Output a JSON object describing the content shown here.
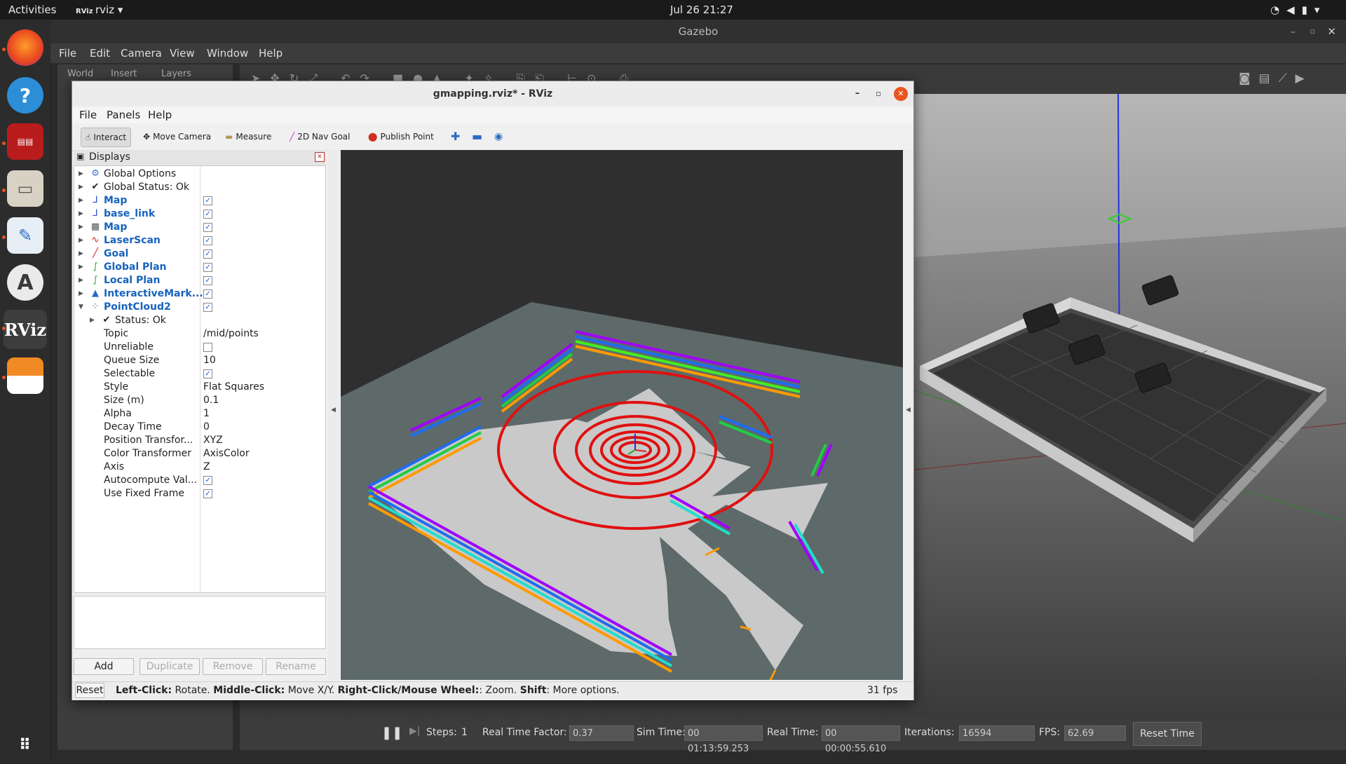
{
  "topbar": {
    "activities": "Activities",
    "app_name": "rviz",
    "clock": "Jul 26  21:27"
  },
  "dock": {
    "rviz_label": "RViz"
  },
  "gazebo": {
    "title": "Gazebo",
    "menu": [
      "File",
      "Edit",
      "Camera",
      "View",
      "Window",
      "Help"
    ],
    "left_tabs": [
      "World",
      "Insert",
      "Layers"
    ],
    "bottom": {
      "steps_label": "Steps:",
      "steps_value": "1",
      "rtf_label": "Real Time Factor:",
      "rtf_value": "0.37",
      "sim_label": "Sim Time:",
      "sim_value": "00 01:13:59.253",
      "real_label": "Real Time:",
      "real_value": "00 00:00:55.610",
      "iter_label": "Iterations:",
      "iter_value": "16594",
      "fps_label": "FPS:",
      "fps_value": "62.69",
      "reset_time": "Reset Time"
    }
  },
  "rviz": {
    "title": "gmapping.rviz* - RViz",
    "menu": [
      "File",
      "Panels",
      "Help"
    ],
    "tools": [
      "Interact",
      "Move Camera",
      "Measure",
      "2D Nav Goal",
      "Publish Point"
    ],
    "panel_title": "Displays",
    "displays": [
      {
        "label": "Global Options",
        "style": "plain",
        "icon": "gear-icon"
      },
      {
        "label": "Global Status: Ok",
        "style": "plain",
        "icon": "check-icon"
      },
      {
        "label": "Map",
        "style": "blue",
        "icon": "axes-icon",
        "checked": true
      },
      {
        "label": "base_link",
        "style": "blue",
        "icon": "axes-icon",
        "checked": true
      },
      {
        "label": "Map",
        "style": "blue",
        "icon": "grid-map-icon",
        "checked": true
      },
      {
        "label": "LaserScan",
        "style": "blue",
        "icon": "laser-icon",
        "checked": true
      },
      {
        "label": "Goal",
        "style": "blue",
        "icon": "arrow-icon",
        "checked": true
      },
      {
        "label": "Global Plan",
        "style": "blue",
        "icon": "path-icon",
        "checked": true
      },
      {
        "label": "Local Plan",
        "style": "blue",
        "icon": "path-icon",
        "checked": true
      },
      {
        "label": "InteractiveMark...",
        "style": "blue",
        "icon": "marker-icon",
        "checked": true
      },
      {
        "label": "PointCloud2",
        "style": "blue",
        "icon": "pointcloud-icon",
        "checked": true
      }
    ],
    "pc2_status": "Status: Ok",
    "properties": [
      {
        "name": "Topic",
        "value": "/mid/points"
      },
      {
        "name": "Unreliable",
        "checkbox": false
      },
      {
        "name": "Queue Size",
        "value": "10"
      },
      {
        "name": "Selectable",
        "checkbox": true
      },
      {
        "name": "Style",
        "value": "Flat Squares"
      },
      {
        "name": "Size (m)",
        "value": "0.1"
      },
      {
        "name": "Alpha",
        "value": "1"
      },
      {
        "name": "Decay Time",
        "value": "0"
      },
      {
        "name": "Position Transfor...",
        "value": "XYZ"
      },
      {
        "name": "Color Transformer",
        "value": "AxisColor"
      },
      {
        "name": "Axis",
        "value": "Z"
      },
      {
        "name": "Autocompute Val...",
        "checkbox": true
      },
      {
        "name": "Use Fixed Frame",
        "checkbox": true
      }
    ],
    "buttons": {
      "add": "Add",
      "duplicate": "Duplicate",
      "remove": "Remove",
      "rename": "Rename"
    },
    "status": {
      "reset": "Reset",
      "b1": "Left-Click:",
      "t1": " Rotate. ",
      "b2": "Middle-Click:",
      "t2": " Move X/Y. ",
      "b3": "Right-Click/Mouse Wheel:",
      "t3": ": Zoom. ",
      "b4": "Shift",
      "t4": ": More options.",
      "fps": "31 fps"
    }
  },
  "colors": {
    "rviz_link": "#1763bd",
    "ubuntu_orange": "#e95420",
    "close_red": "#e95420"
  }
}
